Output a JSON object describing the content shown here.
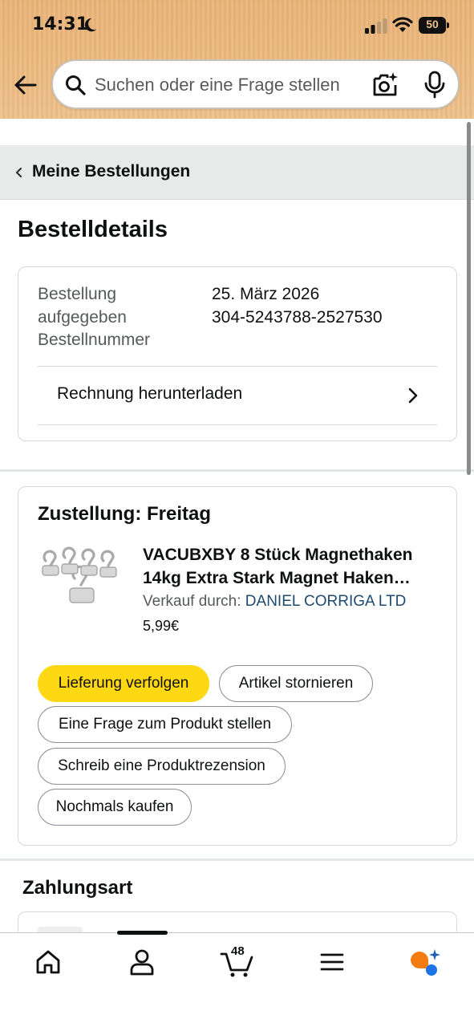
{
  "status_bar": {
    "time": "14:31",
    "battery": "50"
  },
  "search": {
    "placeholder": "Suchen oder eine Frage stellen"
  },
  "breadcrumb": {
    "label": "Meine Bestellungen"
  },
  "page": {
    "title": "Bestelldetails"
  },
  "order_summary": {
    "placed_label_line1": "Bestellung",
    "placed_label_line2": "aufgegeben",
    "number_label": "Bestellnummer",
    "placed_date": "25. März 2026",
    "order_number": "304-5243788-2527530",
    "invoice_label": "Rechnung herunterladen"
  },
  "delivery": {
    "title": "Zustellung: Freitag",
    "product_title": "VACUBXBY 8 Stück Magnethaken 14kg Extra Stark Magnet Haken…",
    "seller_prefix": "Verkauf durch: ",
    "seller_name": "DANIEL CORRIGA LTD",
    "price": "5,99€",
    "actions": {
      "track": "Lieferung verfolgen",
      "cancel": "Artikel stornieren",
      "question": "Eine Frage zum Produkt stellen",
      "review": "Schreib eine Produktrezension",
      "buy_again": "Nochmals kaufen"
    }
  },
  "payment": {
    "title": "Zahlungsart"
  },
  "bottom_nav": {
    "cart_count": "48",
    "items": [
      "home-icon",
      "account-icon",
      "cart-icon",
      "menu-icon",
      "assistant-icon"
    ]
  },
  "colors": {
    "header_bg": "#e9b478",
    "primary_button": "#ffd814",
    "link": "#1f4a70"
  }
}
